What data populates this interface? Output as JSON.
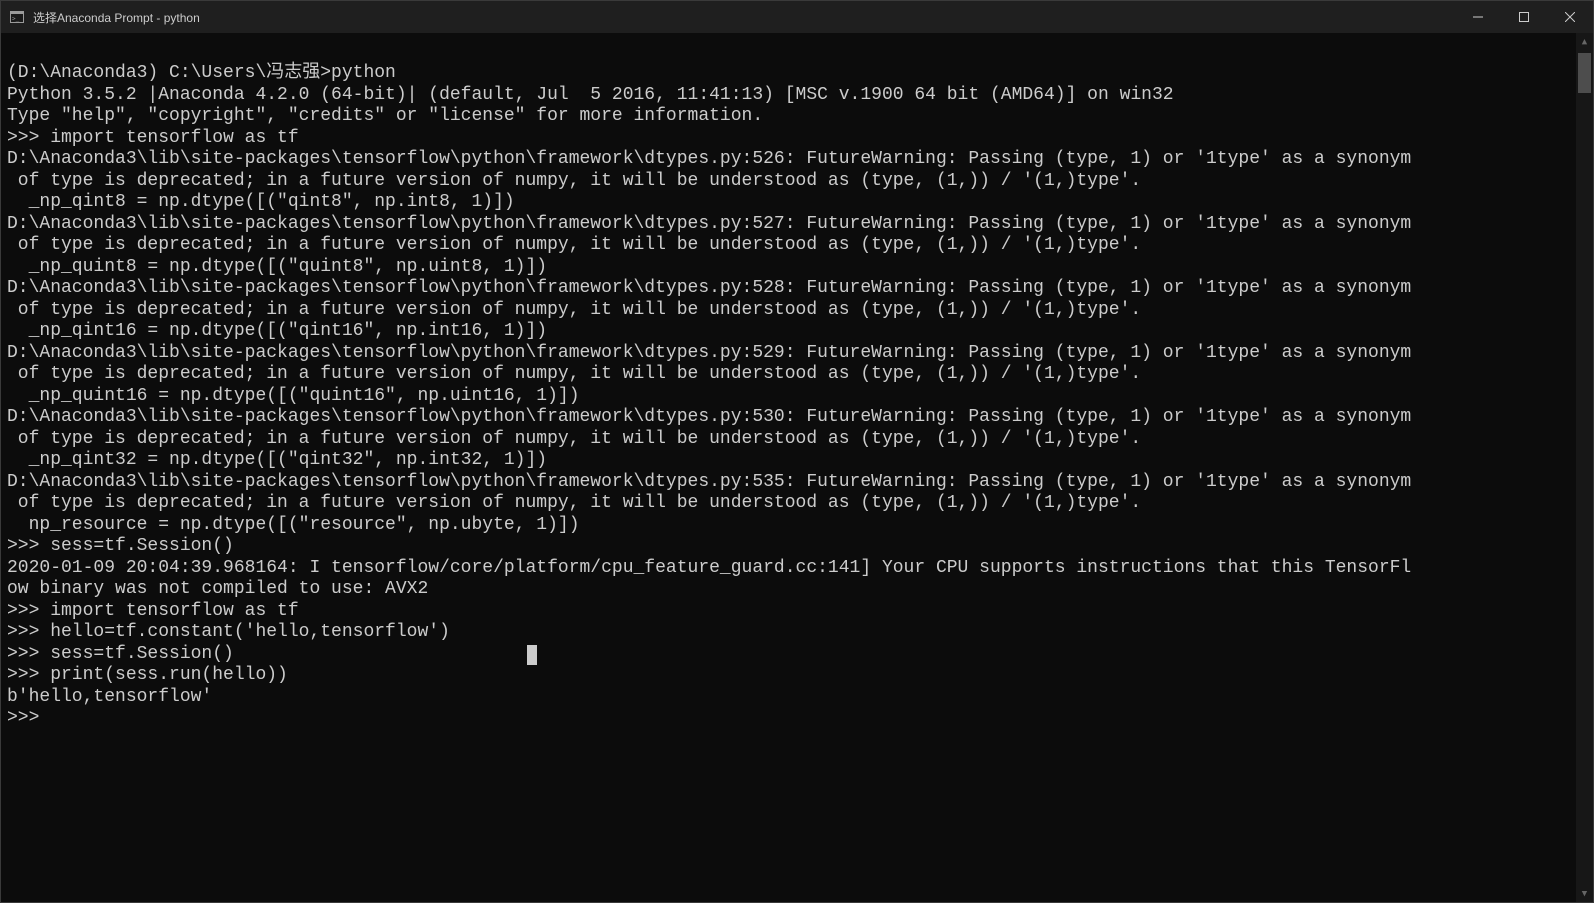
{
  "window": {
    "title": "选择Anaconda Prompt - python",
    "icon_name": "terminal-icon"
  },
  "terminal": {
    "lines": [
      "",
      "(D:\\Anaconda3) C:\\Users\\冯志强>python",
      "Python 3.5.2 |Anaconda 4.2.0 (64-bit)| (default, Jul  5 2016, 11:41:13) [MSC v.1900 64 bit (AMD64)] on win32",
      "Type \"help\", \"copyright\", \"credits\" or \"license\" for more information.",
      ">>> import tensorflow as tf",
      "D:\\Anaconda3\\lib\\site-packages\\tensorflow\\python\\framework\\dtypes.py:526: FutureWarning: Passing (type, 1) or '1type' as a synonym",
      " of type is deprecated; in a future version of numpy, it will be understood as (type, (1,)) / '(1,)type'.",
      "  _np_qint8 = np.dtype([(\"qint8\", np.int8, 1)])",
      "D:\\Anaconda3\\lib\\site-packages\\tensorflow\\python\\framework\\dtypes.py:527: FutureWarning: Passing (type, 1) or '1type' as a synonym",
      " of type is deprecated; in a future version of numpy, it will be understood as (type, (1,)) / '(1,)type'.",
      "  _np_quint8 = np.dtype([(\"quint8\", np.uint8, 1)])",
      "D:\\Anaconda3\\lib\\site-packages\\tensorflow\\python\\framework\\dtypes.py:528: FutureWarning: Passing (type, 1) or '1type' as a synonym",
      " of type is deprecated; in a future version of numpy, it will be understood as (type, (1,)) / '(1,)type'.",
      "  _np_qint16 = np.dtype([(\"qint16\", np.int16, 1)])",
      "D:\\Anaconda3\\lib\\site-packages\\tensorflow\\python\\framework\\dtypes.py:529: FutureWarning: Passing (type, 1) or '1type' as a synonym",
      " of type is deprecated; in a future version of numpy, it will be understood as (type, (1,)) / '(1,)type'.",
      "  _np_quint16 = np.dtype([(\"quint16\", np.uint16, 1)])",
      "D:\\Anaconda3\\lib\\site-packages\\tensorflow\\python\\framework\\dtypes.py:530: FutureWarning: Passing (type, 1) or '1type' as a synonym",
      " of type is deprecated; in a future version of numpy, it will be understood as (type, (1,)) / '(1,)type'.",
      "  _np_qint32 = np.dtype([(\"qint32\", np.int32, 1)])",
      "D:\\Anaconda3\\lib\\site-packages\\tensorflow\\python\\framework\\dtypes.py:535: FutureWarning: Passing (type, 1) or '1type' as a synonym",
      " of type is deprecated; in a future version of numpy, it will be understood as (type, (1,)) / '(1,)type'.",
      "  np_resource = np.dtype([(\"resource\", np.ubyte, 1)])",
      ">>> sess=tf.Session()",
      "2020-01-09 20:04:39.968164: I tensorflow/core/platform/cpu_feature_guard.cc:141] Your CPU supports instructions that this TensorFl",
      "ow binary was not compiled to use: AVX2",
      ">>> import tensorflow as tf",
      ">>> hello=tf.constant('hello,tensorflow')",
      ">>> sess=tf.Session()",
      ">>> print(sess.run(hello))",
      "b'hello,tensorflow'",
      ">>> "
    ],
    "cursor_after_line_index": 28,
    "cursor_col": 48
  }
}
